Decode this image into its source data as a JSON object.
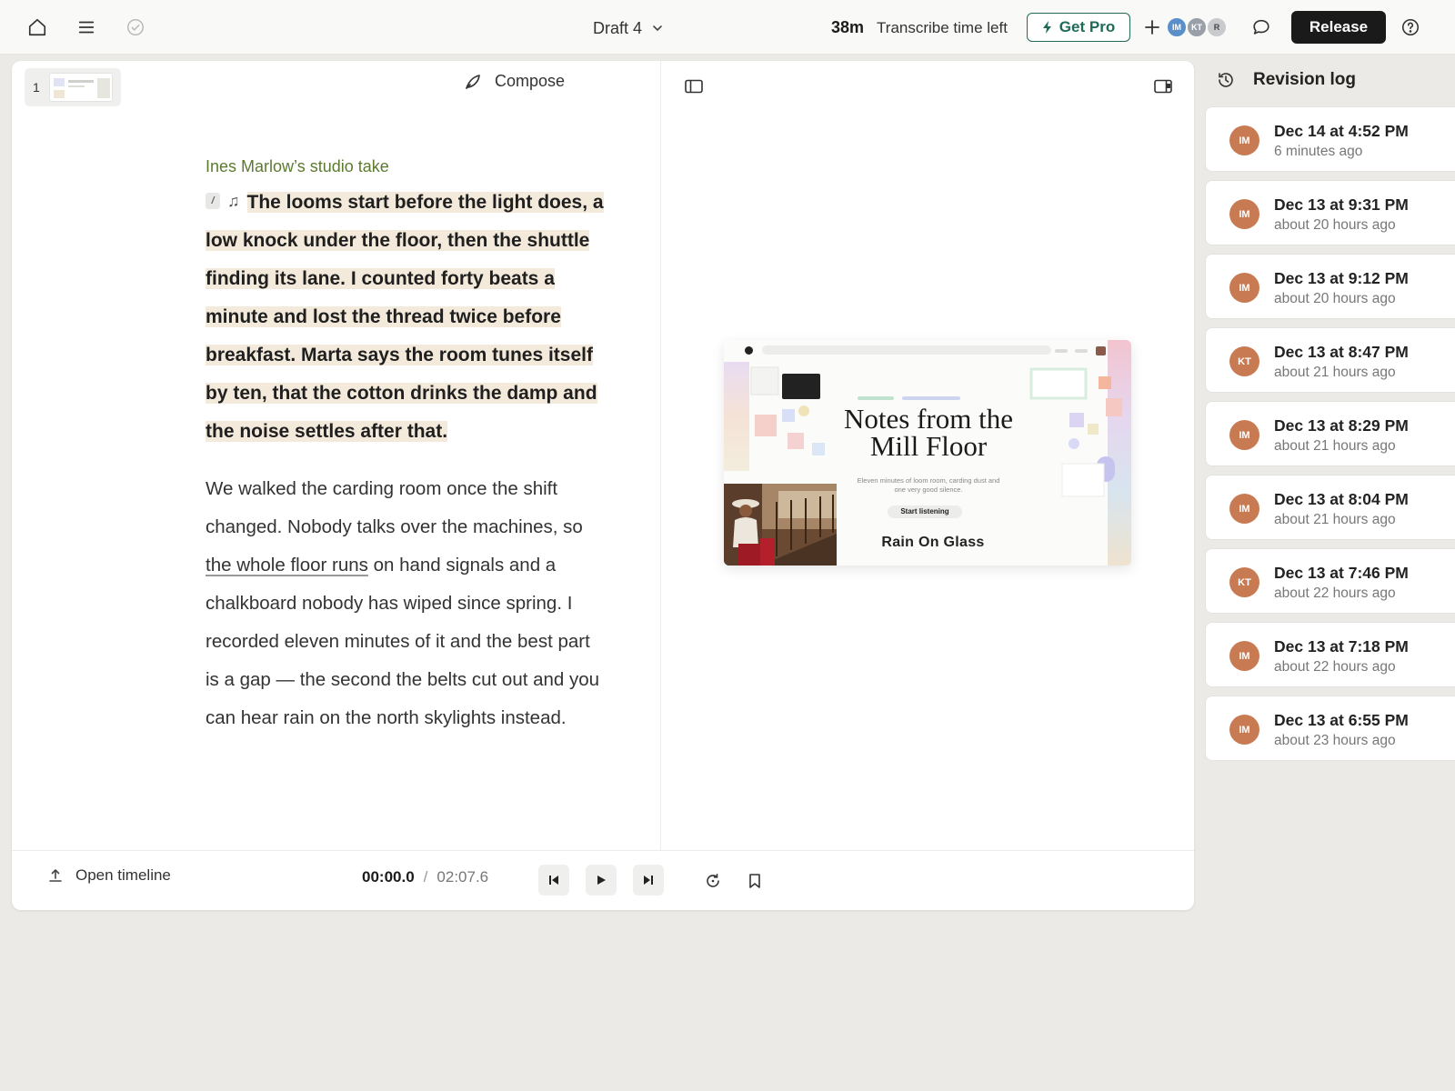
{
  "topbar": {
    "draft_label": "Draft 4",
    "time_left_minutes": "38m",
    "time_left_label": "Transcribe time left",
    "get_pro_label": "Get Pro",
    "release_label": "Release",
    "collaborators": [
      {
        "initials": "IM",
        "color": "#5a8fc9"
      },
      {
        "initials": "KT",
        "color": "#9aa0a8"
      },
      {
        "initials": "R",
        "color": "#c9cacd"
      }
    ]
  },
  "editor": {
    "page_number": "1",
    "compose_label": "Compose",
    "speaker": "Ines Marlow’s studio take",
    "tag_chip": "/",
    "highlight_paragraph": "The looms start before the light does, a low knock under the floor, then the shuttle finding its lane. I counted forty beats a minute and lost the thread twice before breakfast. Marta says the room tunes itself by ten, that the cotton drinks the damp and the noise settles after that.",
    "body_before_link": "We walked the carding room once the shift changed. Nobody talks over the machines, so ",
    "body_link": "the whole floor runs",
    "body_after_link": " on hand signals and a chalkboard nobody has wiped since spring. I recorded eleven minutes of it and the best part is a gap — the second the belts cut out and you can hear rain on the north skylights instead."
  },
  "preview": {
    "title": "Notes from the Mill Floor",
    "subtitle": "Eleven minutes of loom room, carding dust and one very good silence.",
    "button_label": "Start listening",
    "caption": "Rain On Glass"
  },
  "transport": {
    "open_timeline_label": "Open timeline",
    "current_time": "00:00.0",
    "separator": "/",
    "total_time": "02:07.6"
  },
  "revision_log": {
    "title": "Revision log",
    "entries": [
      {
        "initials": "IM",
        "when": "Dec 14 at 4:52 PM",
        "ago": "6 minutes ago"
      },
      {
        "initials": "IM",
        "when": "Dec 13 at 9:31 PM",
        "ago": "about 20 hours ago"
      },
      {
        "initials": "IM",
        "when": "Dec 13 at 9:12 PM",
        "ago": "about 20 hours ago"
      },
      {
        "initials": "KT",
        "when": "Dec 13 at 8:47 PM",
        "ago": "about 21 hours ago"
      },
      {
        "initials": "IM",
        "when": "Dec 13 at 8:29 PM",
        "ago": "about 21 hours ago"
      },
      {
        "initials": "IM",
        "when": "Dec 13 at 8:04 PM",
        "ago": "about 21 hours ago"
      },
      {
        "initials": "KT",
        "when": "Dec 13 at 7:46 PM",
        "ago": "about 22 hours ago"
      },
      {
        "initials": "IM",
        "when": "Dec 13 at 7:18 PM",
        "ago": "about 22 hours ago"
      },
      {
        "initials": "IM",
        "when": "Dec 13 at 6:55 PM",
        "ago": "about 23 hours ago"
      }
    ]
  },
  "colors": {
    "accent_green": "#1f6b58",
    "speaker_green": "#5c7a2f",
    "highlight": "#f3eadb",
    "avatar_orange": "#c87a52"
  }
}
